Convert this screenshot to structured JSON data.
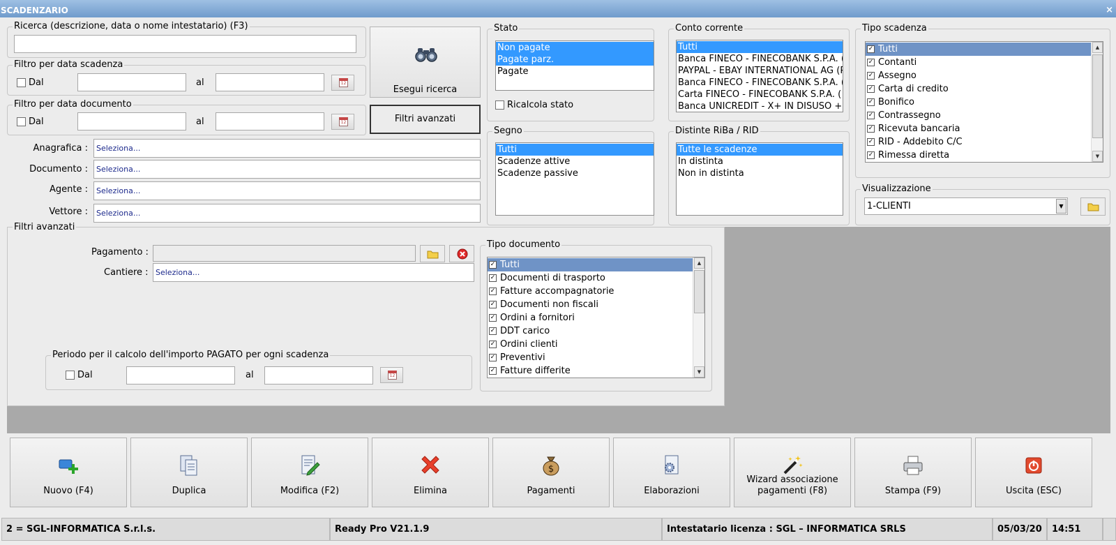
{
  "window": {
    "title": "SCADENZARIO",
    "close": "×"
  },
  "search": {
    "legend": "Ricerca (descrizione, data o nome intestatario) (F3)",
    "value": "",
    "button_label": "Esegui ricerca",
    "advanced_button_label": "Filtri avanzati"
  },
  "date_filter_scadenza": {
    "legend": "Filtro per data scadenza",
    "from_label": "Dal",
    "to_label": "al",
    "calendar_text": "12"
  },
  "date_filter_documento": {
    "legend": "Filtro per data documento",
    "from_label": "Dal",
    "to_label": "al",
    "calendar_text": "12"
  },
  "fields": {
    "anagrafica": {
      "label": "Anagrafica :",
      "value": "Seleziona..."
    },
    "documento": {
      "label": "Documento :",
      "value": "Seleziona..."
    },
    "agente": {
      "label": "Agente :",
      "value": "Seleziona..."
    },
    "vettore": {
      "label": "Vettore :",
      "value": "Seleziona..."
    }
  },
  "stato": {
    "legend": "Stato",
    "items": [
      "Non pagate",
      "Pagate parz.",
      "Pagate"
    ],
    "recalc_label": "Ricalcola stato"
  },
  "conto_corrente": {
    "legend": "Conto corrente",
    "items": [
      "Tutti",
      "Banca FINECO - FINECOBANK S.P.A. (",
      "PAYPAL - EBAY INTERNATIONAL AG (P",
      "Banca FINECO - FINECOBANK S.P.A. (",
      "Carta FINECO - FINECOBANK S.P.A. ( d",
      "Banca UNICREDIT - X+ IN DISUSO + U"
    ]
  },
  "tipo_scadenza": {
    "legend": "Tipo scadenza",
    "items": [
      "Tutti",
      "Contanti",
      "Assegno",
      "Carta di credito",
      "Bonifico",
      "Contrassegno",
      "Ricevuta bancaria",
      "RID - Addebito C/C",
      "Rimessa diretta"
    ]
  },
  "segno": {
    "legend": "Segno",
    "items": [
      "Tutti",
      "Scadenze attive",
      "Scadenze passive"
    ]
  },
  "distinte": {
    "legend": "Distinte RiBa / RID",
    "items": [
      "Tutte le scadenze",
      "In distinta",
      "Non in distinta"
    ]
  },
  "visualizzazione": {
    "legend": "Visualizzazione",
    "value": "1-CLIENTI"
  },
  "filtri_avanzati": {
    "legend": "Filtri avanzati",
    "pagamento_label": "Pagamento :",
    "cantiere_label": "Cantiere :",
    "cantiere_value": "Seleziona...",
    "periodo": {
      "legend": "Periodo per il calcolo dell'importo PAGATO per ogni scadenza",
      "from_label": "Dal",
      "to_label": "al",
      "calendar_text": "12"
    }
  },
  "tipo_documento": {
    "legend": "Tipo documento",
    "items": [
      "Tutti",
      "Documenti di trasporto",
      "Fatture accompagnatorie",
      "Documenti non fiscali",
      "Ordini a fornitori",
      "DDT carico",
      "Ordini clienti",
      "Preventivi",
      "Fatture differite"
    ]
  },
  "toolbar": {
    "nuovo": "Nuovo (F4)",
    "duplica": "Duplica",
    "modifica": "Modifica (F2)",
    "elimina": "Elimina",
    "pagamenti": "Pagamenti",
    "elaborazioni": "Elaborazioni",
    "wizard_line1": "Wizard associazione",
    "wizard_line2": "pagamenti (F8)",
    "stampa": "Stampa (F9)",
    "uscita": "Uscita (ESC)"
  },
  "status": {
    "company": "2 = SGL-INFORMATICA S.r.l.s.",
    "version": "Ready Pro V21.1.9",
    "license": "Intestatario licenza : SGL – INFORMATICA SRLS",
    "date": "05/03/20",
    "time": "14:51"
  },
  "colors": {
    "title_bar": "#7fa6d3",
    "selection": "#3399ff",
    "selection_inactive": "#6f93c6",
    "close_icon": "#e02a2a",
    "panel_bg": "#ececec"
  }
}
